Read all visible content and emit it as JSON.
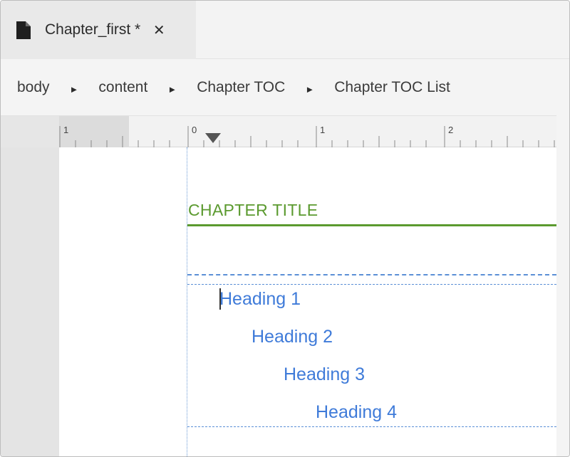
{
  "tab": {
    "title": "Chapter_first *",
    "close_glyph": "✕",
    "icon": "document-icon"
  },
  "breadcrumb": {
    "items": [
      "body",
      "content",
      "Chapter TOC",
      "Chapter TOC List"
    ],
    "separator_glyph": "►"
  },
  "ruler": {
    "labels": [
      "1",
      "0",
      "1",
      "2"
    ]
  },
  "document": {
    "chapter_title": "CHAPTER TITLE",
    "toc_items": [
      "Heading 1",
      "Heading 2",
      "Heading 3",
      "Heading 4"
    ]
  },
  "colors": {
    "chapter_title": "#5b9a2f",
    "toc_link": "#3f7bd9",
    "guide": "#5b8fd6"
  }
}
